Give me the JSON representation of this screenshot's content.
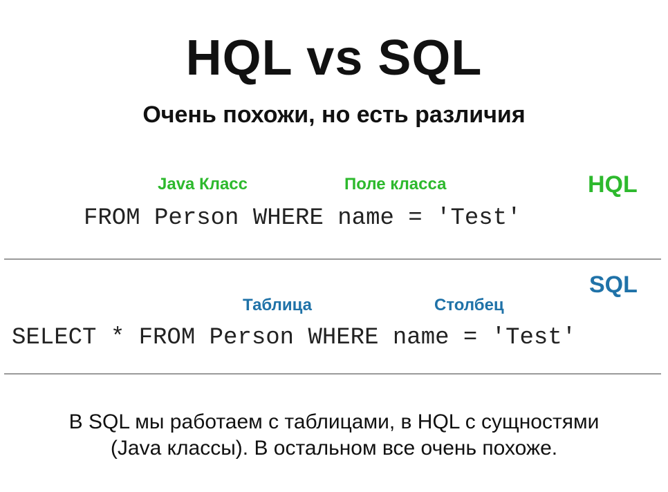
{
  "slide": {
    "title": "HQL vs SQL",
    "subtitle": "Очень похожи, но есть различия"
  },
  "hql": {
    "tag": "HQL",
    "label_class": "Java Класс",
    "label_field": "Поле класса",
    "query": "FROM Person WHERE name = 'Test'"
  },
  "sql": {
    "tag": "SQL",
    "label_table": "Таблица",
    "label_column": "Столбец",
    "query": "SELECT * FROM Person WHERE name = 'Test'"
  },
  "footer": {
    "line1": "В SQL мы работаем с таблицами, в HQL с сущностями",
    "line2": "(Java классы). В остальном все очень похоже."
  },
  "colors": {
    "hql_accent": "#2db92d",
    "sql_accent": "#1f72a8",
    "divider": "#9a9a9a"
  }
}
